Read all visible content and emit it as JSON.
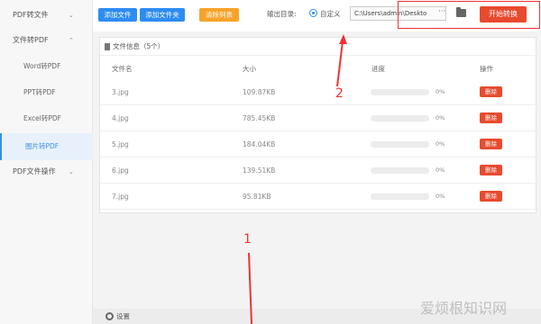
{
  "sidebar": {
    "groups": [
      {
        "label": "PDF转文件"
      },
      {
        "label": "文件转PDF"
      },
      {
        "label": "PDF文件操作"
      }
    ],
    "items": [
      {
        "label": "Word转PDF"
      },
      {
        "label": "PPT转PDF"
      },
      {
        "label": "Excel转PDF"
      },
      {
        "label": "图片转PDF",
        "active": true
      }
    ]
  },
  "toolbar": {
    "add_file": "添加文件",
    "add_folder": "添加文件夹",
    "clear_list": "清除列表",
    "output_label": "输出目录:",
    "custom_label": "自定义",
    "output_path": "C:\\Users\\admin\\Deskto",
    "browse": "···",
    "start": "开始转换"
  },
  "file_panel": {
    "title": "文件信息（5个）",
    "columns": [
      "文件名",
      "大小",
      "进度",
      "操作"
    ],
    "rows": [
      {
        "name": "3.jpg",
        "size": "109.87KB",
        "progress": "0%",
        "action": "删除"
      },
      {
        "name": "4.jpg",
        "size": "785.45KB",
        "progress": "0%",
        "action": "删除"
      },
      {
        "name": "5.jpg",
        "size": "184.04KB",
        "progress": "0%",
        "action": "删除"
      },
      {
        "name": "6.jpg",
        "size": "139.51KB",
        "progress": "0%",
        "action": "删除"
      },
      {
        "name": "7.jpg",
        "size": "95.81KB",
        "progress": "0%",
        "action": "删除"
      }
    ]
  },
  "settings_label": "设置",
  "annotations": {
    "one": "1",
    "two": "2"
  },
  "watermark": "爱烦根知识网",
  "colors": {
    "accent": "#2d8cf0",
    "danger": "#e84a2e",
    "warning": "#f7a22a",
    "annotation": "#e33333"
  }
}
